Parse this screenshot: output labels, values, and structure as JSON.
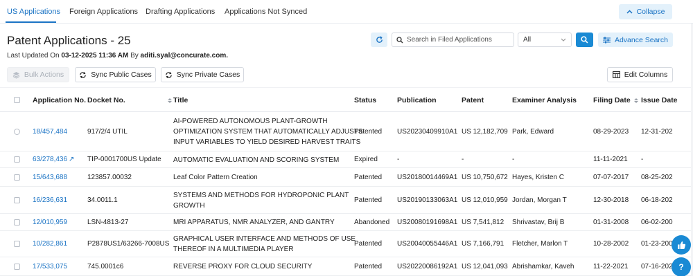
{
  "tabs": [
    {
      "label": "US Applications",
      "active": true
    },
    {
      "label": "Foreign Applications",
      "active": false
    },
    {
      "label": "Drafting Applications",
      "active": false
    },
    {
      "label": "Applications Not Synced",
      "active": false
    }
  ],
  "collapse_label": "Collapse",
  "page_title": "Patent Applications - 25",
  "last_updated": {
    "prefix": "Last Updated On",
    "datetime": "03-12-2025 11:36 AM",
    "by": "By",
    "user": "aditi.syal@concurate.com."
  },
  "search": {
    "placeholder": "Search in Filed Applications",
    "value": ""
  },
  "filter_select": {
    "selected": "All"
  },
  "advanced_search_label": "Advance Search",
  "toolbar": {
    "bulk_actions": "Bulk Actions",
    "sync_public": "Sync Public Cases",
    "sync_private": "Sync Private Cases",
    "edit_columns": "Edit Columns"
  },
  "columns": [
    "Application No.",
    "Docket No.",
    "Title",
    "Status",
    "Publication",
    "Patent",
    "Examiner Analysis",
    "Filing Date",
    "Issue Date"
  ],
  "rows": [
    {
      "app": "18/457,484",
      "docket": "917/2/4 UTIL",
      "title1": "AI-POWERED AUTONOMOUS PLANT-GROWTH",
      "title2": "OPTIMIZATION SYSTEM THAT AUTOMATICALLY ADJUSTS",
      "title3": "INPUT VARIABLES TO YIELD DESIRED HARVEST TRAITS",
      "status": "Patented",
      "publication": "US20230409910A1",
      "patent": "US 12,182,709",
      "examiner": "Park, Edward",
      "filing": "08-29-2023",
      "issue": "12-31-202"
    },
    {
      "app": "63/278,436",
      "docket": "TIP-0001700US Update",
      "title1": "AUTOMATIC EVALUATION AND SCORING SYSTEM",
      "title2": "",
      "title3": "",
      "status": "Expired",
      "publication": "-",
      "patent": "-",
      "examiner": "-",
      "filing": "11-11-2021",
      "issue": "-"
    },
    {
      "app": "15/643,688",
      "docket": "123857.00032",
      "title1": "Leaf Color Pattern Creation",
      "title2": "",
      "title3": "",
      "status": "Patented",
      "publication": "US20180014469A1",
      "patent": "US 10,750,672",
      "examiner": "Hayes, Kristen C",
      "filing": "07-07-2017",
      "issue": "08-25-202"
    },
    {
      "app": "16/236,631",
      "docket": "34.0011.1",
      "title1": "SYSTEMS AND METHODS FOR HYDROPONIC PLANT",
      "title2": "GROWTH",
      "title3": "",
      "status": "Patented",
      "publication": "US20190133063A1",
      "patent": "US 12,010,959",
      "examiner": "Jordan, Morgan T",
      "filing": "12-30-2018",
      "issue": "06-18-202"
    },
    {
      "app": "12/010,959",
      "docket": "LSN-4813-27",
      "title1": "MRI APPARATUS, NMR ANALYZER, AND GANTRY",
      "title2": "",
      "title3": "",
      "status": "Abandoned",
      "publication": "US20080191698A1",
      "patent": "US 7,541,812",
      "examiner": "Shrivastav, Brij B",
      "filing": "01-31-2008",
      "issue": "06-02-200"
    },
    {
      "app": "10/282,861",
      "docket": "P2878US1/63266-7008US",
      "title1": "GRAPHICAL USER INTERFACE AND METHODS OF USE",
      "title2": "THEREOF IN A MULTIMEDIA PLAYER",
      "title3": "",
      "status": "Patented",
      "publication": "US20040055446A1",
      "patent": "US 7,166,791",
      "examiner": "Fletcher, Marlon T",
      "filing": "10-28-2002",
      "issue": "01-23-200"
    },
    {
      "app": "17/533,075",
      "docket": "745.0001c6",
      "title1": "REVERSE PROXY FOR CLOUD SECURITY",
      "title2": "",
      "title3": "",
      "status": "Patented",
      "publication": "US20220086192A1",
      "patent": "US 12,041,093",
      "examiner": "Abrishamkar, Kaveh",
      "filing": "11-22-2021",
      "issue": "07-16-202"
    }
  ],
  "colors": {
    "accent": "#1a73c4",
    "button_blue": "#1a8ad4",
    "light_blue": "#e3f1fb"
  },
  "icons": {
    "collapse": "chevron-up-icon",
    "refresh": "refresh-icon",
    "search": "search-icon",
    "advanced": "sliders-icon",
    "sync": "sync-icon",
    "columns": "columns-icon",
    "thumbs": "thumbs-up-icon",
    "help": "help-icon"
  }
}
